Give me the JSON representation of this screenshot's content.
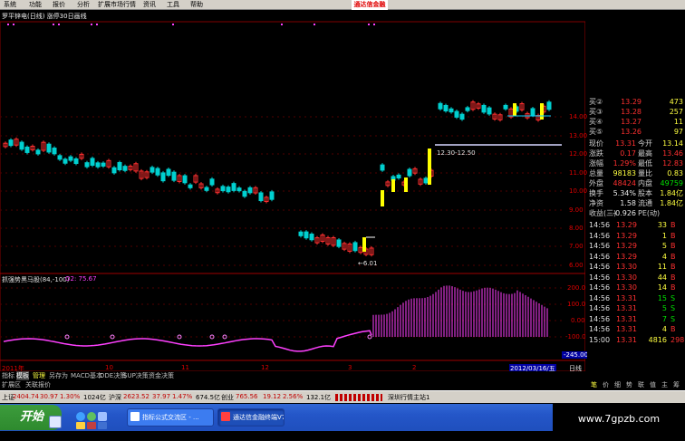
{
  "menu": [
    "系统",
    "功能",
    "报价",
    "分析",
    "扩展市场行情",
    "资讯",
    "工具",
    "帮助"
  ],
  "brand": "通达信金融",
  "title": "罗平锌电(日线) 涨停30日画线",
  "price_axis": [
    "14.00",
    "13.00",
    "12.00",
    "11.00",
    "10.00",
    "9.00",
    "8.00",
    "7.00",
    "6.00"
  ],
  "annotations": {
    "range": "12.30-12.50",
    "low": "←6.01"
  },
  "indicator": {
    "name": "抓强势黑马股(84,-100)",
    "value": "O2: 75.67",
    "axis": [
      "200.0",
      "100.0",
      "0.00",
      "-100.0"
    ],
    "neg_label": "-245.00"
  },
  "date_axis": [
    "2011年",
    "10",
    "11",
    "12",
    "2",
    "3",
    "2012/03/16/五"
  ],
  "period_label": "日线",
  "quote": {
    "asks": [
      {
        "label": "买③",
        "price": "13.28",
        "vol": "257"
      },
      {
        "label": "买④",
        "price": "13.27",
        "vol": "11"
      },
      {
        "label": "买⑤",
        "price": "13.26",
        "vol": "97"
      }
    ],
    "asks_top": [
      {
        "label": "买②",
        "price": "13.29",
        "vol": "473"
      }
    ],
    "rows": [
      {
        "l1": "现价",
        "v1": "13.31",
        "l2": "今开",
        "v2": "13.14"
      },
      {
        "l1": "涨跌",
        "v1": "0.17",
        "l2": "最高",
        "v2": "13.46"
      },
      {
        "l1": "涨幅",
        "v1": "1.29%",
        "l2": "最低",
        "v2": "12.83"
      },
      {
        "l1": "总量",
        "v1": "98183",
        "l2": "量比",
        "v2": "0.83"
      },
      {
        "l1": "外盘",
        "v1": "48424",
        "l2": "内盘",
        "v2": "49759"
      },
      {
        "l1": "换手",
        "v1": "5.34%",
        "l2": "股本",
        "v2": "1.84亿"
      },
      {
        "l1": "净资",
        "v1": "1.58",
        "l2": "流通",
        "v2": "1.84亿"
      },
      {
        "l1": "收益(三)",
        "v1": "-0.926",
        "l2": "PE(动)",
        "v2": ""
      }
    ]
  },
  "trades": [
    {
      "t": "14:56",
      "p": "13.29",
      "v": "33",
      "bs": "B"
    },
    {
      "t": "14:56",
      "p": "13.29",
      "v": "1",
      "bs": "B"
    },
    {
      "t": "14:56",
      "p": "13.29",
      "v": "5",
      "bs": "B"
    },
    {
      "t": "14:56",
      "p": "13.29",
      "v": "4",
      "bs": "B"
    },
    {
      "t": "14:56",
      "p": "13.30",
      "v": "11",
      "bs": "B"
    },
    {
      "t": "14:56",
      "p": "13.30",
      "v": "44",
      "bs": "B"
    },
    {
      "t": "14:56",
      "p": "13.30",
      "v": "14",
      "bs": "B"
    },
    {
      "t": "14:56",
      "p": "13.31",
      "v": "15",
      "bs": "S"
    },
    {
      "t": "14:56",
      "p": "13.31",
      "v": "5",
      "bs": "S"
    },
    {
      "t": "14:56",
      "p": "13.31",
      "v": "7",
      "bs": "S"
    },
    {
      "t": "14:56",
      "p": "13.31",
      "v": "4",
      "bs": "B"
    },
    {
      "t": "15:00",
      "p": "13.31",
      "v": "4816",
      "bs": "298"
    }
  ],
  "tabs1": [
    "指标",
    "模板",
    "管理",
    "另存为",
    "MACD基本",
    "DDE决策",
    "SUP决策",
    "资金决策"
  ],
  "tabs2": [
    "扩展区",
    "关联报价"
  ],
  "side_tabs": [
    "笔",
    "价",
    "细",
    "势",
    "联",
    "值",
    "主",
    "筹"
  ],
  "status": {
    "sh_label": "上证",
    "sh": "2404.74",
    "sh_chg": "30.97",
    "sh_pct": "1.30%",
    "sh_amt": "1024亿",
    "sz_label": "沪深",
    "sz": "2623.52",
    "sz_chg": "37.97",
    "sz_pct": "1.47%",
    "sz_amt": "674.5亿",
    "cy_label": "创业",
    "cy": "765.56",
    "cy_chg": "19.12",
    "cy_pct": "2.56%",
    "cy_amt": "132.1亿",
    "server": "深圳行情主站1"
  },
  "taskbar": {
    "start": "开始",
    "items": [
      "指标公式交流区 - ...",
      "通达信金融终端V7..."
    ]
  },
  "watermark": "www.7gpzb.com",
  "colors": {
    "up": "#ff3030",
    "down": "#00d0d0",
    "yellow": "#ffff00",
    "magenta": "#ff40ff",
    "grid": "#800000"
  }
}
